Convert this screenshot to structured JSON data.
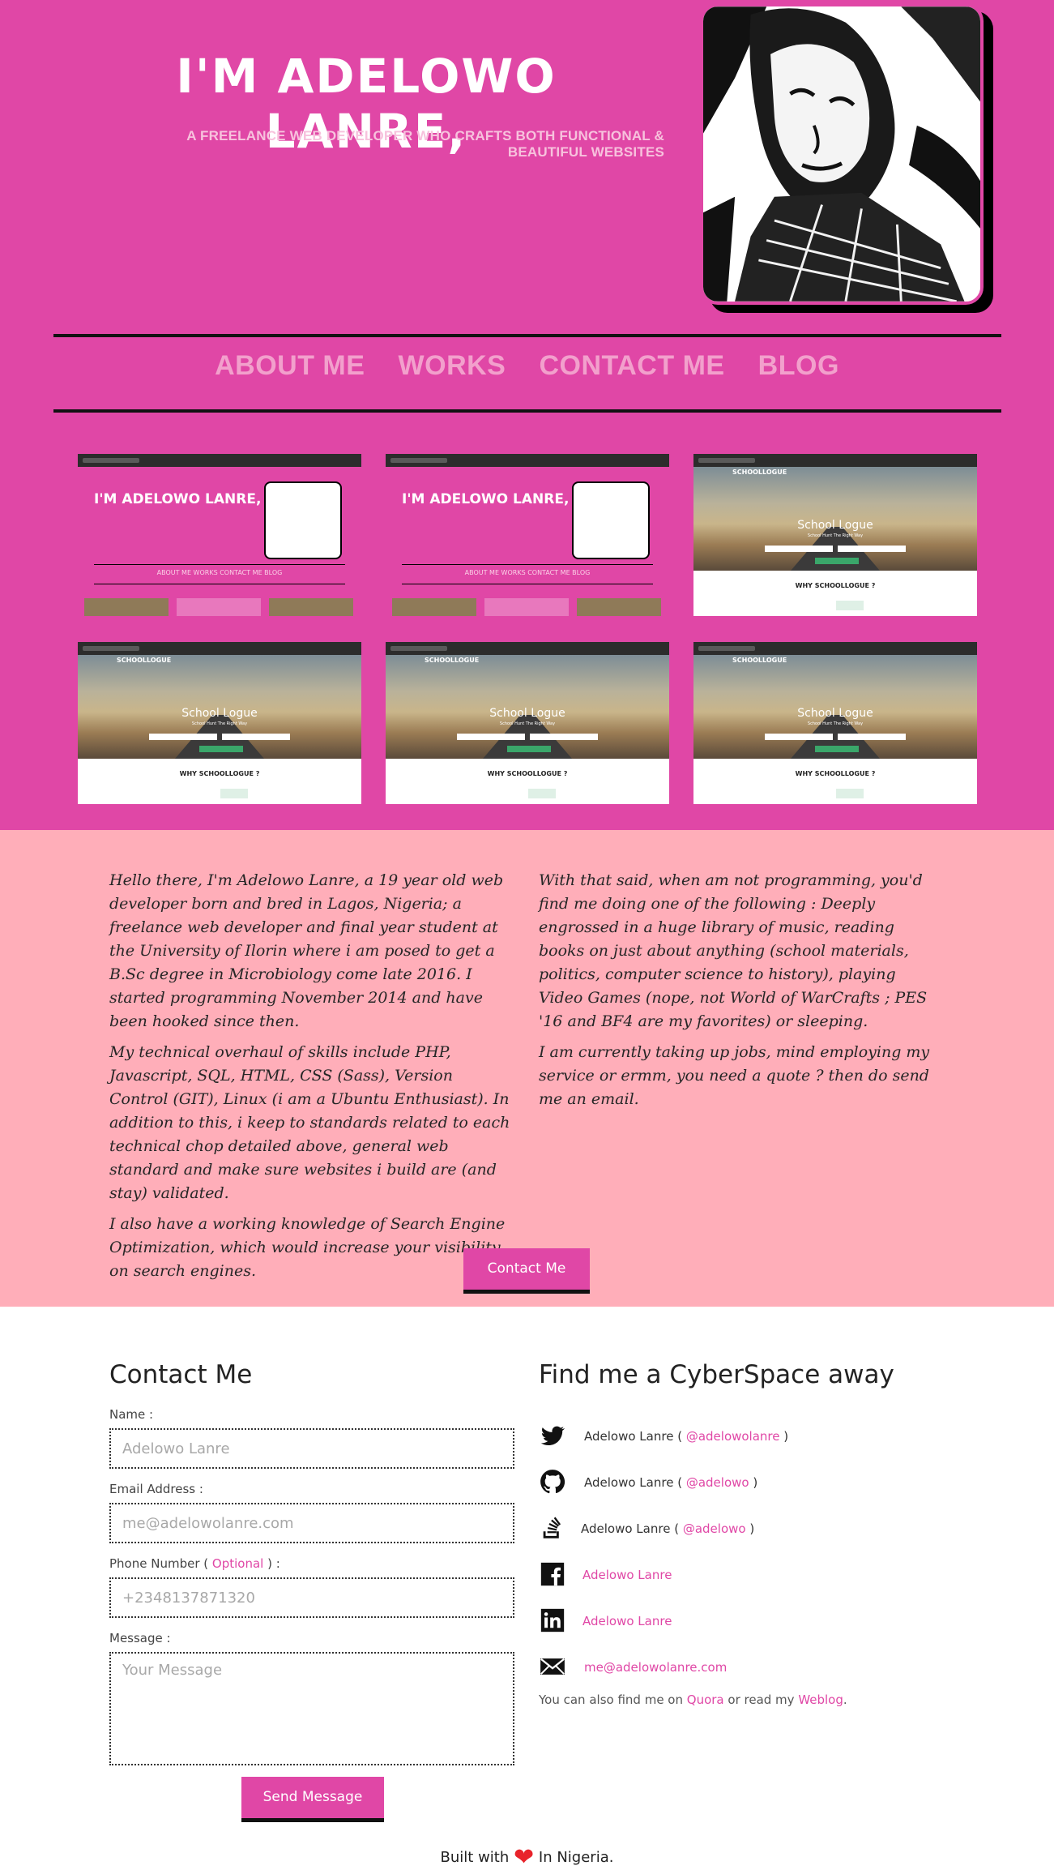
{
  "hero": {
    "title": "I'M ADELOWO LANRE,",
    "subtitle": "A FREELANCE WEB DEVELOPER WHO CRAFTS BOTH FUNCTIONAL & BEAUTIFUL WEBSITES"
  },
  "nav": {
    "items": [
      "ABOUT ME",
      "WORKS",
      "CONTACT ME",
      "BLOG"
    ]
  },
  "works": {
    "portfolio_title": "I'M ADELOWO LANRE,",
    "portfolio_nav": "ABOUT ME   WORKS   CONTACT ME   BLOG",
    "school_brand": "SCHOOLLOGUE",
    "school_title": "School Logue",
    "school_sub": "School Hunt The Right Way",
    "school_why": "WHY SCHOOLLOGUE ?"
  },
  "about": {
    "left": [
      "Hello there, I'm Adelowo Lanre, a 19 year old web developer born and bred in Lagos, Nigeria; a freelance web developer and final year student at the University of Ilorin where i am posed to get a B.Sc degree in Microbiology come late 2016. I started programming November 2014 and have been hooked since then.",
      "My technical overhaul of skills include PHP, Javascript, SQL, HTML, CSS (Sass), Version Control (GIT), Linux (i am a Ubuntu Enthusiast). In addition to this, i keep to standards related to each technical chop detailed above, general web standard and make sure websites i build are (and stay) validated.",
      "I also have a working knowledge of Search Engine Optimization, which would increase your visibility on search engines."
    ],
    "right": [
      "With that said, when am not programming, you'd find me doing one of the following : Deeply engrossed in a huge library of music, reading books on just about anything (school materials, politics, computer science to history), playing Video Games (nope, not World of WarCrafts ; PES '16 and BF4 are my favorites) or sleeping.",
      "I am currently taking up jobs, mind employing my service or ermm, you need a quote ? then do send me an email."
    ],
    "contact_button": "Contact Me"
  },
  "contact": {
    "heading": "Contact Me",
    "name_label": "Name :",
    "name_placeholder": "Adelowo Lanre",
    "email_label": "Email Address :",
    "email_placeholder": "me@adelowolanre.com",
    "phone_label_pre": "Phone Number ( ",
    "phone_label_opt": "Optional",
    "phone_label_post": " ) :",
    "phone_placeholder": "+2348137871320",
    "message_label": "Message :",
    "message_placeholder": "Your Message",
    "send_button": "Send Message"
  },
  "social": {
    "heading": "Find me a CyberSpace away",
    "twitter": {
      "name": "Adelowo Lanre ( ",
      "handle": "@adelowolanre",
      "close": " )"
    },
    "github": {
      "name": "Adelowo Lanre ( ",
      "handle": "@adelowo",
      "close": " )"
    },
    "stackoverflow": {
      "name": "Adelowo Lanre ( ",
      "handle": "@adelowo",
      "close": " )"
    },
    "facebook": {
      "link": "Adelowo Lanre"
    },
    "linkedin": {
      "link": "Adelowo Lanre"
    },
    "email": {
      "link": "me@adelowolanre.com"
    },
    "also_pre": "You can also find me on ",
    "also_quora": "Quora",
    "also_mid": " or read my ",
    "also_blog": "Weblog",
    "also_post": "."
  },
  "footer": {
    "pre": "Built with",
    "post": "In Nigeria."
  },
  "colors": {
    "hero_bg": "#e047a6",
    "about_bg": "#ffaeb9",
    "nav_text": "#f2a0cc",
    "link": "#e047a6",
    "heart": "#e8232b"
  }
}
